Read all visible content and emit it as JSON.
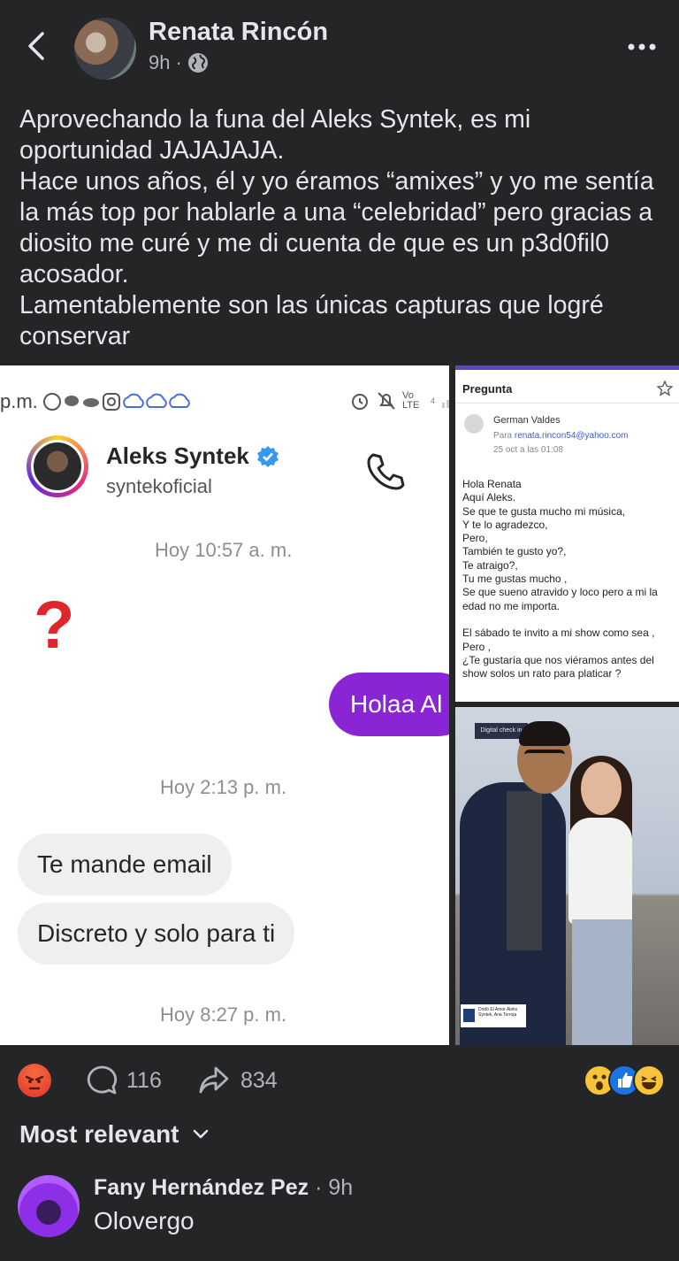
{
  "header": {
    "author": "Renata Rincón",
    "time": "9h",
    "separator": "·",
    "back_icon": "chevron-left-icon",
    "privacy_icon": "globe-icon",
    "more_icon": "more-horizontal-icon"
  },
  "post": {
    "text": "Aprovechando la funa del Aleks Syntek, es mi oportunidad JAJAJAJA.\nHace unos años, él y yo éramos “amixes” y yo me sentía la más top por hablarle a una “celebridad” pero gracias a diosito me curé y me di cuenta de que es un p3d0fil0 acosador.\nLamentablemente son las únicas capturas que logré conservar"
  },
  "screenshot": {
    "status_left": "p.m.",
    "status_lte": "Vo LTE",
    "status_signal": "4",
    "contact_name": "Aleks Syntek",
    "contact_handle": "syntekoficial",
    "stamp1": "Hoy 10:57 a. m.",
    "question": "?",
    "outgoing": "Holaa Al",
    "stamp2": "Hoy 2:13 p. m.",
    "msg1": "Te mande email",
    "msg2": "Discreto y solo para ti",
    "stamp3": "Hoy 8:27 p. m."
  },
  "email": {
    "title": "Pregunta",
    "sender": "German Valdes",
    "to_label": "Para",
    "to_address": "renata.rincon54@yahoo.com",
    "date": "25 oct a las 01:08",
    "body": "Hola Renata\nAquí Aleks.\nSe que te gusta mucho mi música,\nY te lo agradezco,\nPero,\nTambién te gusto yo?,\nTe atraigo?,\nTu me gustas mucho ,\nSe que sueno atravido y loco pero a mi la edad no me importa.\n\nEl sábado te invito a mi show como sea ,\nPero ,\n¿Te gustaría que nos viéramos antes del show solos un rato para platicar ?"
  },
  "photo": {
    "sign_text": "Digital check in",
    "badge_text": "Dodó El Amor Aleks Syntek, Ana Torroja"
  },
  "reactions": {
    "comments": "116",
    "shares": "834",
    "angry_icon": "angry-reaction-icon",
    "comment_icon": "comment-icon",
    "share_icon": "share-icon"
  },
  "comments_section": {
    "sort_label": "Most relevant",
    "comment": {
      "name": "Fany Hernández Pez",
      "time": "9h",
      "text": "Olovergo"
    }
  },
  "colors": {
    "background": "#242526",
    "text": "#e4e6eb",
    "muted": "#b0b3b8",
    "accent_purple": "#8a25d6"
  }
}
